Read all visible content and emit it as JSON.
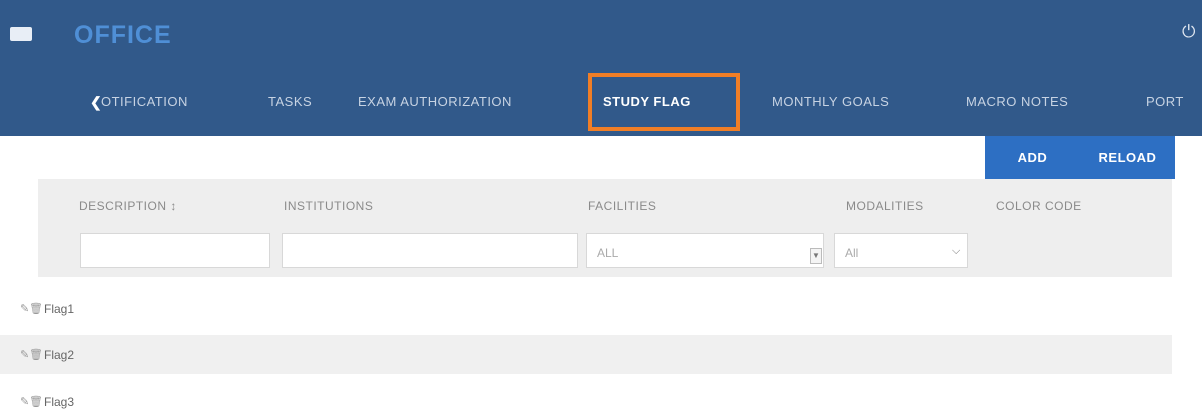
{
  "header": {
    "title": "OFFICE"
  },
  "tabs": [
    {
      "label": "OTIFICATION"
    },
    {
      "label": "TASKS"
    },
    {
      "label": "EXAM AUTHORIZATION"
    },
    {
      "label": "STUDY FLAG"
    },
    {
      "label": "MONTHLY GOALS"
    },
    {
      "label": "MACRO NOTES"
    },
    {
      "label": "PORT"
    }
  ],
  "toolbar": {
    "add_label": "ADD",
    "reload_label": "RELOAD"
  },
  "table": {
    "columns": [
      "DESCRIPTION",
      "INSTITUTIONS",
      "FACILITIES",
      "MODALITIES",
      "COLOR CODE"
    ],
    "sort_indicator": "↕",
    "filters": {
      "description": "",
      "institutions": "",
      "facilities": "ALL",
      "modalities": "All"
    },
    "rows": [
      {
        "name": "Flag1"
      },
      {
        "name": "Flag2"
      },
      {
        "name": "Flag3"
      }
    ]
  },
  "icons": {
    "edit": "pencil-icon",
    "delete": "trash-icon",
    "power": "power-icon",
    "menu": "menu-icon"
  },
  "colors": {
    "header_bg": "#31598a",
    "accent": "#2d6fc3",
    "highlight": "#f07e26"
  }
}
